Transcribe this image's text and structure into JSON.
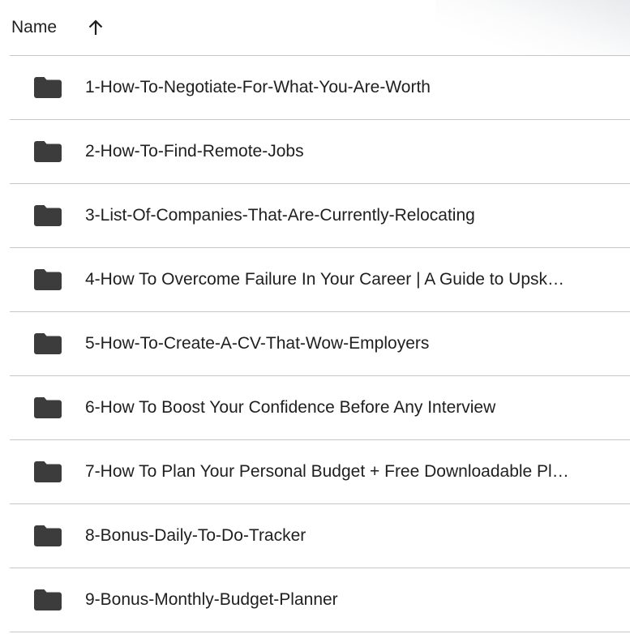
{
  "header": {
    "name_label": "Name",
    "sort_direction": "ascending",
    "sort_icon": "arrow-up-icon"
  },
  "colors": {
    "text": "#1f1f1f",
    "icon": "#3c3c3c",
    "divider": "#c7c7c7",
    "background": "#ffffff"
  },
  "folders": [
    {
      "label": "1-How-To-Negotiate-For-What-You-Are-Worth",
      "icon": "folder-icon"
    },
    {
      "label": "2-How-To-Find-Remote-Jobs",
      "icon": "folder-icon"
    },
    {
      "label": "3-List-Of-Companies-That-Are-Currently-Relocating",
      "icon": "folder-icon"
    },
    {
      "label": "4-How To Overcome Failure In Your Career | A Guide to Upsk…",
      "icon": "folder-icon"
    },
    {
      "label": "5-How-To-Create-A-CV-That-Wow-Employers",
      "icon": "folder-icon"
    },
    {
      "label": "6-How To Boost Your Confidence Before Any Interview",
      "icon": "folder-icon"
    },
    {
      "label": "7-How To Plan Your Personal Budget + Free Downloadable Pl…",
      "icon": "folder-icon"
    },
    {
      "label": "8-Bonus-Daily-To-Do-Tracker",
      "icon": "folder-icon"
    },
    {
      "label": "9-Bonus-Monthly-Budget-Planner",
      "icon": "folder-icon"
    }
  ]
}
